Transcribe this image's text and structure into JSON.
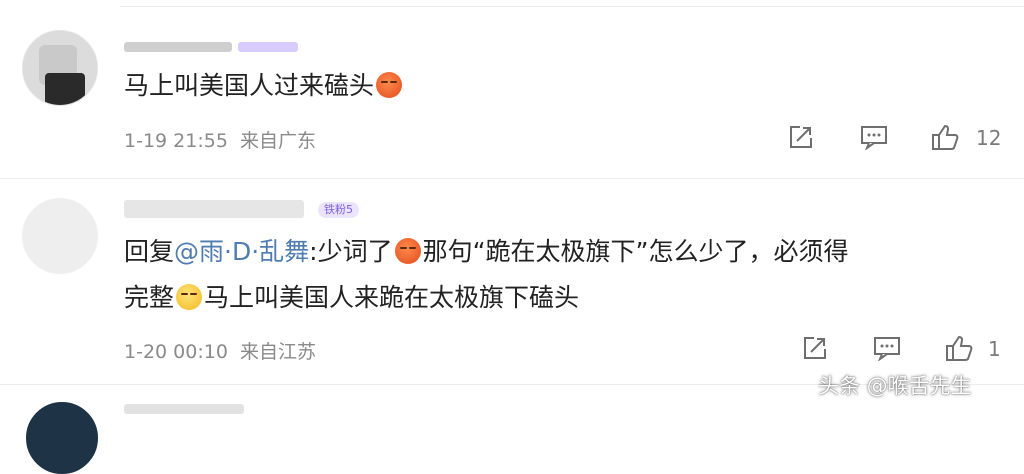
{
  "comments": [
    {
      "text": "马上叫美国人过来磕头",
      "time": "1-19 21:55",
      "location": "来自广东",
      "likes": "12",
      "emoji": "angry-face-icon"
    },
    {
      "mention": "@雨·D·乱舞",
      "reply_prefix": "回复",
      "text_part1": ":少词了",
      "text_part2": "那句“跪在太极旗下”怎么少了，必须得",
      "text_line2_part1": "完整",
      "text_line2_part2": "马上叫美国人来跪在太极旗下磕头",
      "fan_badge": "铁粉5",
      "time": "1-20 00:10",
      "location": "来自江苏",
      "likes": "1",
      "emoji1": "angry-face-icon",
      "emoji2": "grin-face-icon"
    }
  ],
  "watermark": "头条 @喉舌先生",
  "colors": {
    "mention": "#507daf",
    "meta": "#8a8a8a"
  }
}
